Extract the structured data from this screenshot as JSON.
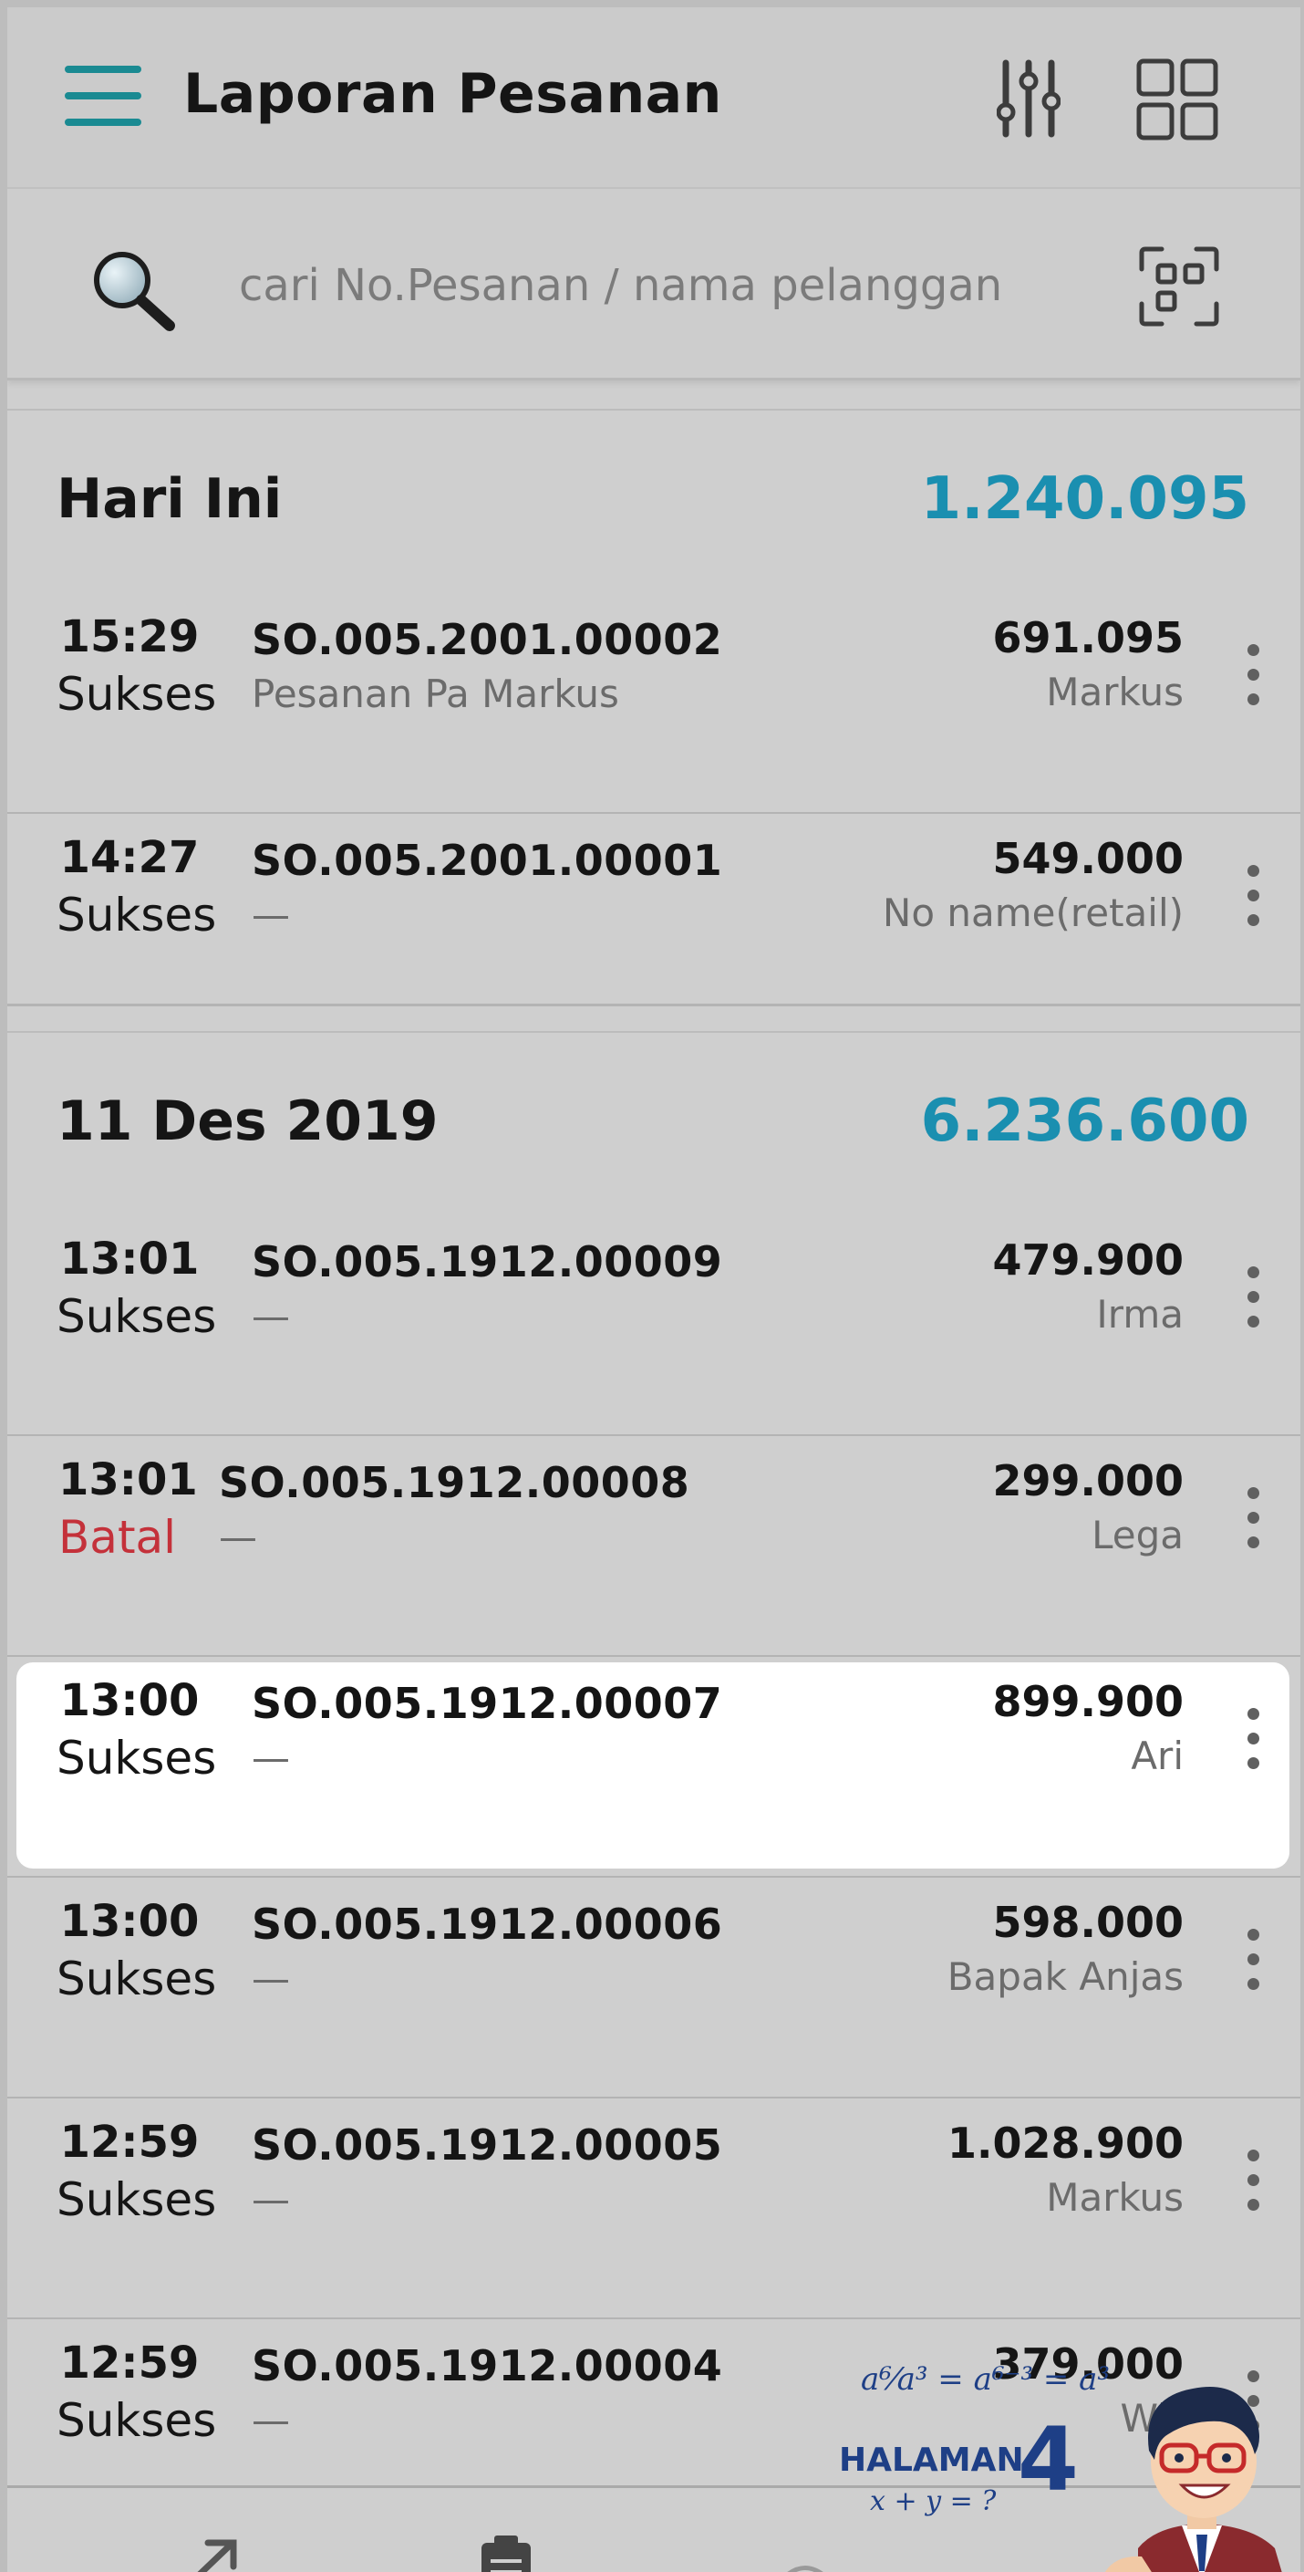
{
  "header": {
    "title": "Laporan Pesanan",
    "menu_icon": "hamburger-menu-icon",
    "filter_icon": "filter-sliders-icon",
    "grid_icon": "grid-view-icon",
    "accent_color": "#1a8a92"
  },
  "search": {
    "placeholder": "cari No.Pesanan / nama pelanggan",
    "value": "",
    "icon": "search-icon",
    "scan_icon": "barcode-scan-icon"
  },
  "sections": [
    {
      "date": "Hari Ini",
      "total": "1.240.095",
      "orders": [
        {
          "time": "15:29",
          "status": "Sukses",
          "order_no": "SO.005.2001.00002",
          "note": "Pesanan Pa Markus",
          "amount": "691.095",
          "customer": "Markus"
        },
        {
          "time": "14:27",
          "status": "Sukses",
          "order_no": "SO.005.2001.00001",
          "note": "—",
          "amount": "549.000",
          "customer": "No name(retail)"
        }
      ]
    },
    {
      "date": "11 Des 2019",
      "total": "6.236.600",
      "orders": [
        {
          "time": "13:01",
          "status": "Sukses",
          "order_no": "SO.005.1912.00009",
          "note": "—",
          "amount": "479.900",
          "customer": "Irma"
        },
        {
          "time": "13:01",
          "status": "Batal",
          "order_no": "SO.005.1912.00008",
          "note": "—",
          "amount": "299.000",
          "customer": "Lega"
        },
        {
          "time": "13:00",
          "status": "Sukses",
          "order_no": "SO.005.1912.00007",
          "note": "—",
          "amount": "899.900",
          "customer": "Ari",
          "selected": true
        },
        {
          "time": "13:00",
          "status": "Sukses",
          "order_no": "SO.005.1912.00006",
          "note": "—",
          "amount": "598.000",
          "customer": "Bapak Anjas"
        },
        {
          "time": "12:59",
          "status": "Sukses",
          "order_no": "SO.005.1912.00005",
          "note": "—",
          "amount": "1.028.900",
          "customer": "Markus"
        },
        {
          "time": "12:59",
          "status": "Sukses",
          "order_no": "SO.005.1912.00004",
          "note": "—",
          "amount": "379.000",
          "customer": "Wir"
        }
      ]
    }
  ],
  "colors": {
    "total": "#1a8fb0",
    "status_batal": "#c4313a",
    "status_sukses": "#151515"
  },
  "promo": {
    "formula": "a⁶⁄a³ = a⁶⁻³ = a³",
    "label": "HALAMAN",
    "number": "4",
    "sub": "x + y = ?"
  }
}
